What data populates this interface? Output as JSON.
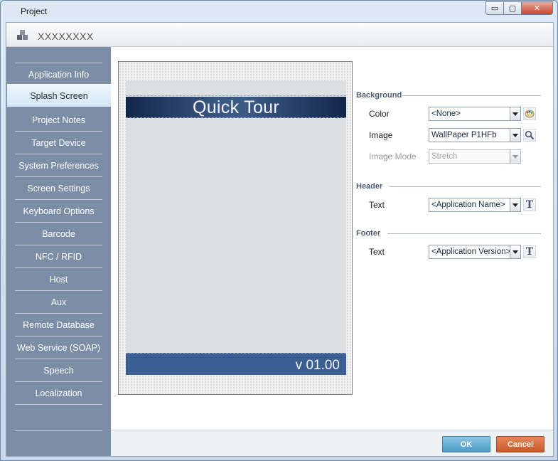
{
  "window": {
    "title": "Project",
    "minimize_glyph": "▭",
    "maximize_glyph": "▢",
    "close_glyph": "✕"
  },
  "header": {
    "project_name": "XXXXXXXX",
    "icon": "project-blocks-icon"
  },
  "sidebar": {
    "active_index": 1,
    "items": [
      {
        "label": "Application Info"
      },
      {
        "label": "Splash Screen"
      },
      {
        "label": "Project Notes"
      },
      {
        "label": "Target Device"
      },
      {
        "label": "System Preferences"
      },
      {
        "label": "Screen Settings"
      },
      {
        "label": "Keyboard Options"
      },
      {
        "label": "Barcode"
      },
      {
        "label": "NFC / RFID"
      },
      {
        "label": "Host"
      },
      {
        "label": "Aux"
      },
      {
        "label": "Remote Database"
      },
      {
        "label": "Web Service (SOAP)"
      },
      {
        "label": "Speech"
      },
      {
        "label": "Localization"
      }
    ]
  },
  "preview": {
    "header_text": "Quick Tour",
    "footer_text": "v 01.00",
    "header_color": "#1f3a63",
    "footer_color": "#3b5f92"
  },
  "settings": {
    "background": {
      "section": "Background",
      "color_label": "Color",
      "color_value": "<None>",
      "color_button_icon": "palette-icon",
      "image_label": "Image",
      "image_value": "WallPaper P1HFb",
      "image_button_icon": "magnifier-icon",
      "image_mode_label": "Image Mode",
      "image_mode_value": "Stretch"
    },
    "header": {
      "section": "Header",
      "text_label": "Text",
      "text_value": "<Application Name>",
      "font_button_glyph": "T"
    },
    "footer": {
      "section": "Footer",
      "text_label": "Text",
      "text_value": "<Application Version>",
      "font_button_glyph": "T"
    }
  },
  "buttons": {
    "ok": "OK",
    "cancel": "Cancel"
  }
}
